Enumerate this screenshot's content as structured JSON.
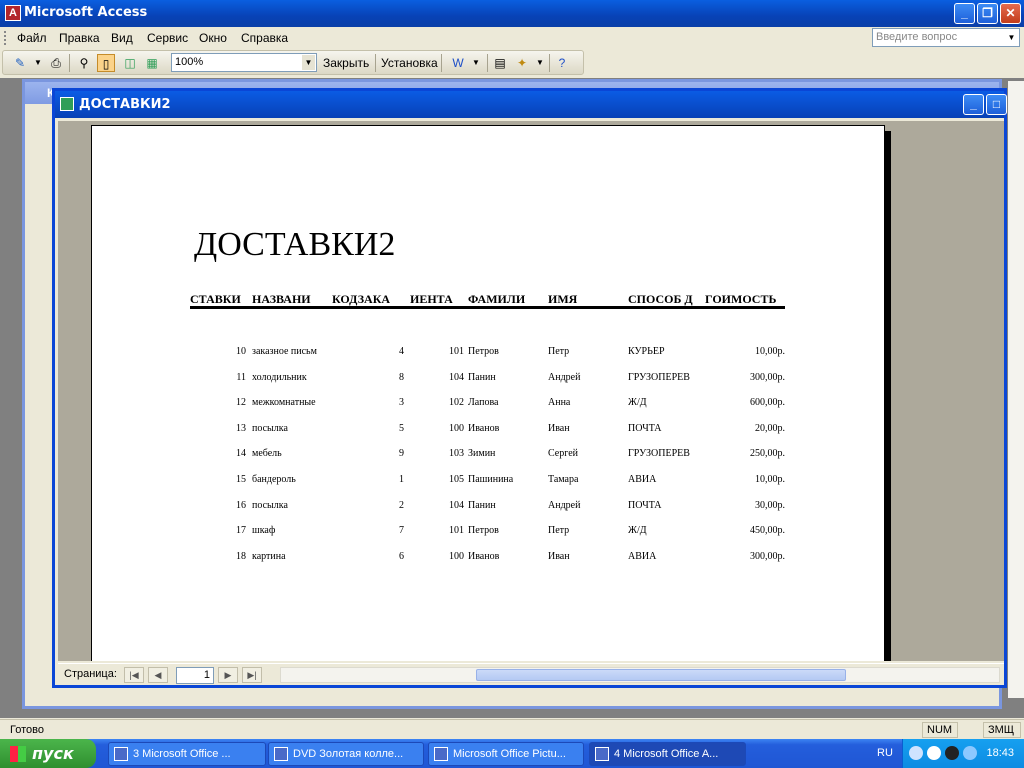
{
  "app": {
    "title": "Microsoft Access",
    "icon_text": "A"
  },
  "menu": {
    "items": [
      "Файл",
      "Правка",
      "Вид",
      "Сервис",
      "Окно",
      "Справка"
    ],
    "ask_placeholder": "Введите вопрос"
  },
  "toolbar": {
    "zoom": "100%",
    "close_label": "Закрыть",
    "setup_label": "Установка"
  },
  "background_window": {
    "title": "К"
  },
  "report_window": {
    "title": "ДОСТАВКИ2"
  },
  "report": {
    "title": "ДОСТАВКИ2",
    "columns": [
      "СТАВКИ",
      "НАЗВАНИ",
      "КОДЗАКА",
      "ИЕНТА",
      "ФАМИЛИ",
      "ИМЯ",
      "СПОСОБ Д",
      "ГОИМОСТЬ"
    ],
    "rows": [
      [
        "10",
        "заказное письм",
        "4",
        "101",
        "Петров",
        "Петр",
        "КУРЬЕР",
        "10,00р."
      ],
      [
        "11",
        "холодильник",
        "8",
        "104",
        "Панин",
        "Андрей",
        "ГРУЗОПЕРЕВ",
        "300,00р."
      ],
      [
        "12",
        "межкомнатные",
        "3",
        "102",
        "Лапова",
        "Анна",
        "Ж/Д",
        "600,00р."
      ],
      [
        "13",
        "посылка",
        "5",
        "100",
        "Иванов",
        "Иван",
        "ПОЧТА",
        "20,00р."
      ],
      [
        "14",
        "мебель",
        "9",
        "103",
        "Зимин",
        "Сергей",
        "ГРУЗОПЕРЕВ",
        "250,00р."
      ],
      [
        "15",
        "бандероль",
        "1",
        "105",
        "Пашинина",
        "Тамара",
        "АВИА",
        "10,00р."
      ],
      [
        "16",
        "посылка",
        "2",
        "104",
        "Панин",
        "Андрей",
        "ПОЧТА",
        "30,00р."
      ],
      [
        "17",
        "шкаф",
        "7",
        "101",
        "Петров",
        "Петр",
        "Ж/Д",
        "450,00р."
      ],
      [
        "18",
        "картина",
        "6",
        "100",
        "Иванов",
        "Иван",
        "АВИА",
        "300,00р."
      ]
    ]
  },
  "pager": {
    "label": "Страница:",
    "current": "1"
  },
  "status": {
    "text": "Готово",
    "num": "NUM",
    "zmsh": "ЗМЩ"
  },
  "taskbar": {
    "start": "пуск",
    "tasks": [
      "3 Microsoft Office ...",
      "DVD  Золотая колле...",
      "Microsoft Office Pictu...",
      "4 Microsoft Office A..."
    ],
    "lang": "RU",
    "clock": "18:43"
  }
}
